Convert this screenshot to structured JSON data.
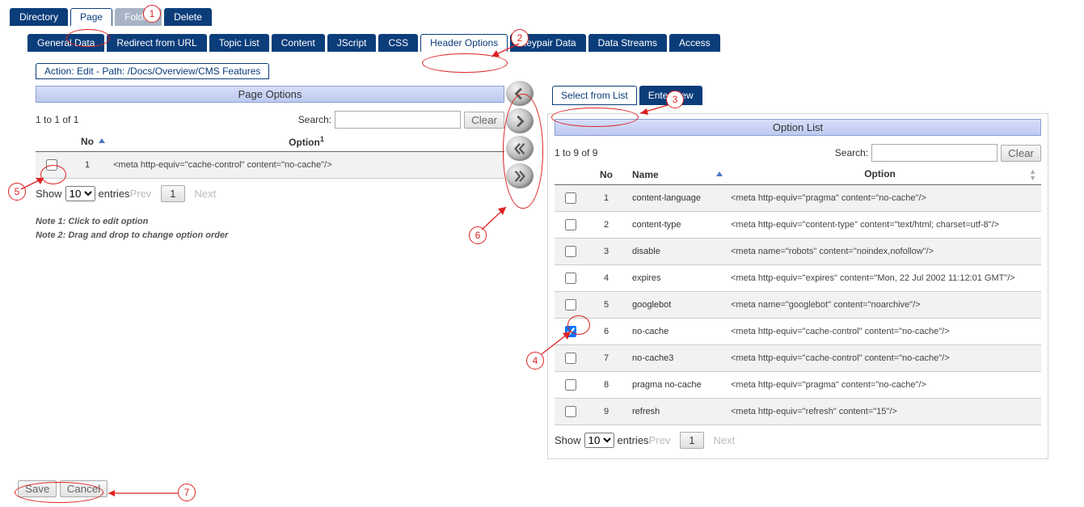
{
  "topTabs": {
    "directory": "Directory",
    "page": "Page",
    "folder": "Folder",
    "delete": "Delete"
  },
  "subTabs": {
    "general": "General Data",
    "redirect": "Redirect from URL",
    "topic": "Topic List",
    "content": "Content",
    "jscript": "JScript",
    "css": "CSS",
    "header": "Header Options",
    "keypair": "Keypair Data",
    "streams": "Data Streams",
    "access": "Access"
  },
  "pathBar": "Action: Edit - Path: /Docs/Overview/CMS Features",
  "left": {
    "title": "Page Options",
    "count": "1 to 1 of 1",
    "searchLabel": "Search:",
    "clear": "Clear",
    "cols": {
      "no": "No",
      "option": "Option",
      "optSup": "1"
    },
    "rows": [
      {
        "no": "1",
        "opt": "<meta http-equiv=\"cache-control\" content=\"no-cache\"/>",
        "checked": false
      }
    ],
    "show": "Show",
    "entries": "entries",
    "selectVal": "10",
    "prev": "Prev",
    "next": "Next",
    "page": "1",
    "note1": "Note 1: Click to edit option",
    "note2": "Note 2: Drag and drop to change option order"
  },
  "rightTabs": {
    "select": "Select from List",
    "enter": "Enter New"
  },
  "right": {
    "title": "Option List",
    "count": "1 to 9 of 9",
    "searchLabel": "Search:",
    "clear": "Clear",
    "cols": {
      "no": "No",
      "name": "Name",
      "option": "Option"
    },
    "rows": [
      {
        "no": "1",
        "name": "content-language",
        "opt": "<meta http-equiv=\"pragma\" content=\"no-cache\"/>",
        "checked": false
      },
      {
        "no": "2",
        "name": "content-type",
        "opt": "<meta http-equiv=\"content-type\" content=\"text/html; charset=utf-8\"/>",
        "checked": false
      },
      {
        "no": "3",
        "name": "disable",
        "opt": "<meta name=\"robots\" content=\"noindex,nofollow\"/>",
        "checked": false
      },
      {
        "no": "4",
        "name": "expires",
        "opt": "<meta http-equiv=\"expires\" content=\"Mon, 22 Jul 2002 11:12:01 GMT\"/>",
        "checked": false
      },
      {
        "no": "5",
        "name": "googlebot",
        "opt": "<meta name=\"googlebot\" content=\"noarchive\"/>",
        "checked": false
      },
      {
        "no": "6",
        "name": "no-cache",
        "opt": "<meta http-equiv=\"cache-control\" content=\"no-cache\"/>",
        "checked": true
      },
      {
        "no": "7",
        "name": "no-cache3",
        "opt": "<meta http-equiv=\"cache-control\" content=\"no-cache\"/>",
        "checked": false
      },
      {
        "no": "8",
        "name": "pragma no-cache",
        "opt": "<meta http-equiv=\"pragma\" content=\"no-cache\"/>",
        "checked": false
      },
      {
        "no": "9",
        "name": "refresh",
        "opt": "<meta http-equiv=\"refresh\" content=\"15\"/>",
        "checked": false
      }
    ],
    "show": "Show",
    "entries": "entries",
    "selectVal": "10",
    "prev": "Prev",
    "next": "Next",
    "page": "1"
  },
  "bottom": {
    "save": "Save",
    "cancel": "Cancel"
  },
  "annotations": {
    "1": "1",
    "2": "2",
    "3": "3",
    "4": "4",
    "5": "5",
    "6": "6",
    "7": "7"
  }
}
